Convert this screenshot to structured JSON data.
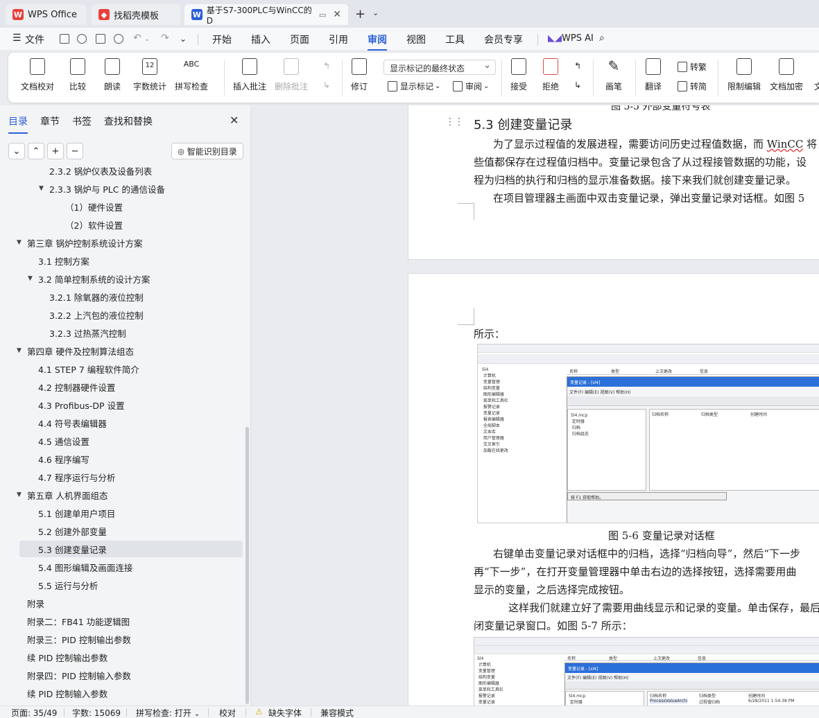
{
  "tabs": [
    {
      "label": "WPS Office",
      "icon": "wps-logo-icon",
      "color": "#e8413c"
    },
    {
      "label": "找稻壳模板",
      "icon": "docer-icon",
      "color": "#e8413c"
    },
    {
      "label": "基于S7-300PLC与WinCC的D",
      "icon": "word-doc-icon",
      "color": "#2b5fd9"
    }
  ],
  "menu": {
    "file": "文件",
    "items": [
      "开始",
      "插入",
      "页面",
      "引用",
      "审阅",
      "视图",
      "工具",
      "会员专享"
    ],
    "active": "审阅",
    "ai": "WPS AI"
  },
  "ribbon": {
    "proofread": "文档校对",
    "compare": "比较",
    "read_aloud": "朗读",
    "word_count": "字数统计",
    "spell_check": "拼写检查",
    "spell_icon_text": "ABC",
    "count_icon_text": "12",
    "insert_comment": "插入批注",
    "delete_comment": "删除批注",
    "revise": "修订",
    "markup_select": "显示标记的最终状态",
    "show_markup": "显示标记",
    "review": "审阅",
    "accept": "接受",
    "reject": "拒绝",
    "pen": "画笔",
    "translate": "翻译",
    "to_traditional": "转繁",
    "to_simplified": "转简",
    "restrict_edit": "限制编辑",
    "encrypt": "文档加密",
    "cut_label": "文"
  },
  "nav": {
    "tabs": [
      "目录",
      "章节",
      "书签",
      "查找和替换"
    ],
    "smart_button": "智能识别目录",
    "toc": [
      {
        "label": "2.3.2 锅炉仪表及设备列表",
        "level": 3,
        "arrow": ""
      },
      {
        "label": "2.3.3  锅炉与 PLC 的通信设备",
        "level": 3,
        "arrow": "▼"
      },
      {
        "label": "（1）硬件设置",
        "level": 4,
        "arrow": ""
      },
      {
        "label": "（2）软件设置",
        "level": 4,
        "arrow": ""
      },
      {
        "label": "第三章  锅炉控制系统设计方案",
        "level": 1,
        "arrow": "▼"
      },
      {
        "label": "3.1  控制方案",
        "level": 2,
        "arrow": ""
      },
      {
        "label": "3.2  简单控制系统的设计方案",
        "level": 2,
        "arrow": "▼"
      },
      {
        "label": "3.2.1  除氧器的液位控制",
        "level": 3,
        "arrow": ""
      },
      {
        "label": "3.2.2 上汽包的液位控制",
        "level": 3,
        "arrow": ""
      },
      {
        "label": "3.2.3  过热蒸汽控制",
        "level": 3,
        "arrow": ""
      },
      {
        "label": "第四章  硬件及控制算法组态",
        "level": 1,
        "arrow": "▼"
      },
      {
        "label": "4.1 STEP 7  编程软件简介",
        "level": 2,
        "arrow": ""
      },
      {
        "label": "4.2  控制器硬件设置",
        "level": 2,
        "arrow": ""
      },
      {
        "label": "4.3 Profibus-DP 设置",
        "level": 2,
        "arrow": ""
      },
      {
        "label": "4.4  符号表编辑器",
        "level": 2,
        "arrow": ""
      },
      {
        "label": "4.5  通信设置",
        "level": 2,
        "arrow": ""
      },
      {
        "label": "4.6  程序编写",
        "level": 2,
        "arrow": ""
      },
      {
        "label": "4.7  程序运行与分析",
        "level": 2,
        "arrow": ""
      },
      {
        "label": "第五章  人机界面组态",
        "level": 1,
        "arrow": "▼"
      },
      {
        "label": "5.1 创建单用户项目",
        "level": 2,
        "arrow": ""
      },
      {
        "label": "5.2  创建外部变量",
        "level": 2,
        "arrow": ""
      },
      {
        "label": "5.3 创建变量记录",
        "level": 2,
        "arrow": "",
        "selected": true
      },
      {
        "label": "5.4  图形编辑及画面连接",
        "level": 2,
        "arrow": ""
      },
      {
        "label": "5.5  运行与分析",
        "level": 2,
        "arrow": ""
      },
      {
        "label": "附录",
        "level": 1,
        "arrow": ""
      },
      {
        "label": "附录二：FB41 功能逻辑图",
        "level": 1,
        "arrow": ""
      },
      {
        "label": "附录三：PID 控制输出参数",
        "level": 1,
        "arrow": ""
      },
      {
        "label": "续 PID 控制输出参数",
        "level": 1,
        "arrow": ""
      },
      {
        "label": "附录四：PID 控制输入参数",
        "level": 1,
        "arrow": ""
      },
      {
        "label": "续 PID 控制输入参数",
        "level": 1,
        "arrow": ""
      }
    ]
  },
  "doc": {
    "top_caption": "图 5-5 外部变量符号表",
    "heading": "5.3 创建变量记录",
    "para1_l1a": "为了显示过程值的发展进程，需要访问历史过程值数据，而 ",
    "para1_l1b": "WinCC",
    "para1_l1c": " 将",
    "para1_l2": "些值都保存在过程值归档中。变量记录包含了从过程接管数据的功能，设",
    "para1_l3": "程为归档的执行和归档的显示准备数据。接下来我们就创建变量记录。",
    "para2": "在项目管理器主画面中双击变量记录，弹出变量记录对话框。如图 5",
    "para3": "所示：",
    "fig_caption": "图 5-6  变量记录对话框",
    "para4_l1": "右键单击变量记录对话框中的归档，选择“归档向导”，然后“下一步",
    "para4_l2": "再“下一步”，在打开变量管理器中单击右边的选择按钮，选择需要用曲",
    "para4_l3": "显示的变量，之后选择完成按钮。",
    "para5_l1": "这样我们就建立好了需要用曲线显示和记录的变量。单击保存，最后",
    "para5_l2": "闭变量记录窗口。如图 5-7 所示：",
    "shot1": {
      "tree": "Sl4\n 计算机\n 变量管理\n 结构变量\n 图形编辑器\n 菜单和工具栏\n 报警记录\n 变量记录\n 报表编辑器\n 全局脚本\n 文本库\n 用户管理器\n 交叉索引\n 加载在线更改",
      "header_cols": [
        "名称",
        "类型",
        "上次更改",
        "信息"
      ],
      "subwindow_title": "变量记录 - [sl4]",
      "subwindow_menu": "文件(F)  编辑(E)  视图(V)  帮助(H)",
      "sub_tree": "Sl4.mcp\n 定时器\n 归档\n 归档组态",
      "sub_cols": [
        "归档名称",
        "归档类型",
        "创建时间"
      ],
      "status": "按 F1 获取帮助。"
    },
    "shot2": {
      "row_text": "ProcessValueArchi",
      "row_type": "过程值归档",
      "row_date": "6/28/2011 1:54:38 PM"
    }
  },
  "status": {
    "page": "页面: 35/49",
    "words": "字数: 15069",
    "spell": "拼写检查: 打开",
    "proof": "校对",
    "missing_font": "缺失字体",
    "compat": "兼容模式"
  },
  "colors": {
    "accent": "#2b5fd9",
    "wps_red": "#e8413c"
  }
}
